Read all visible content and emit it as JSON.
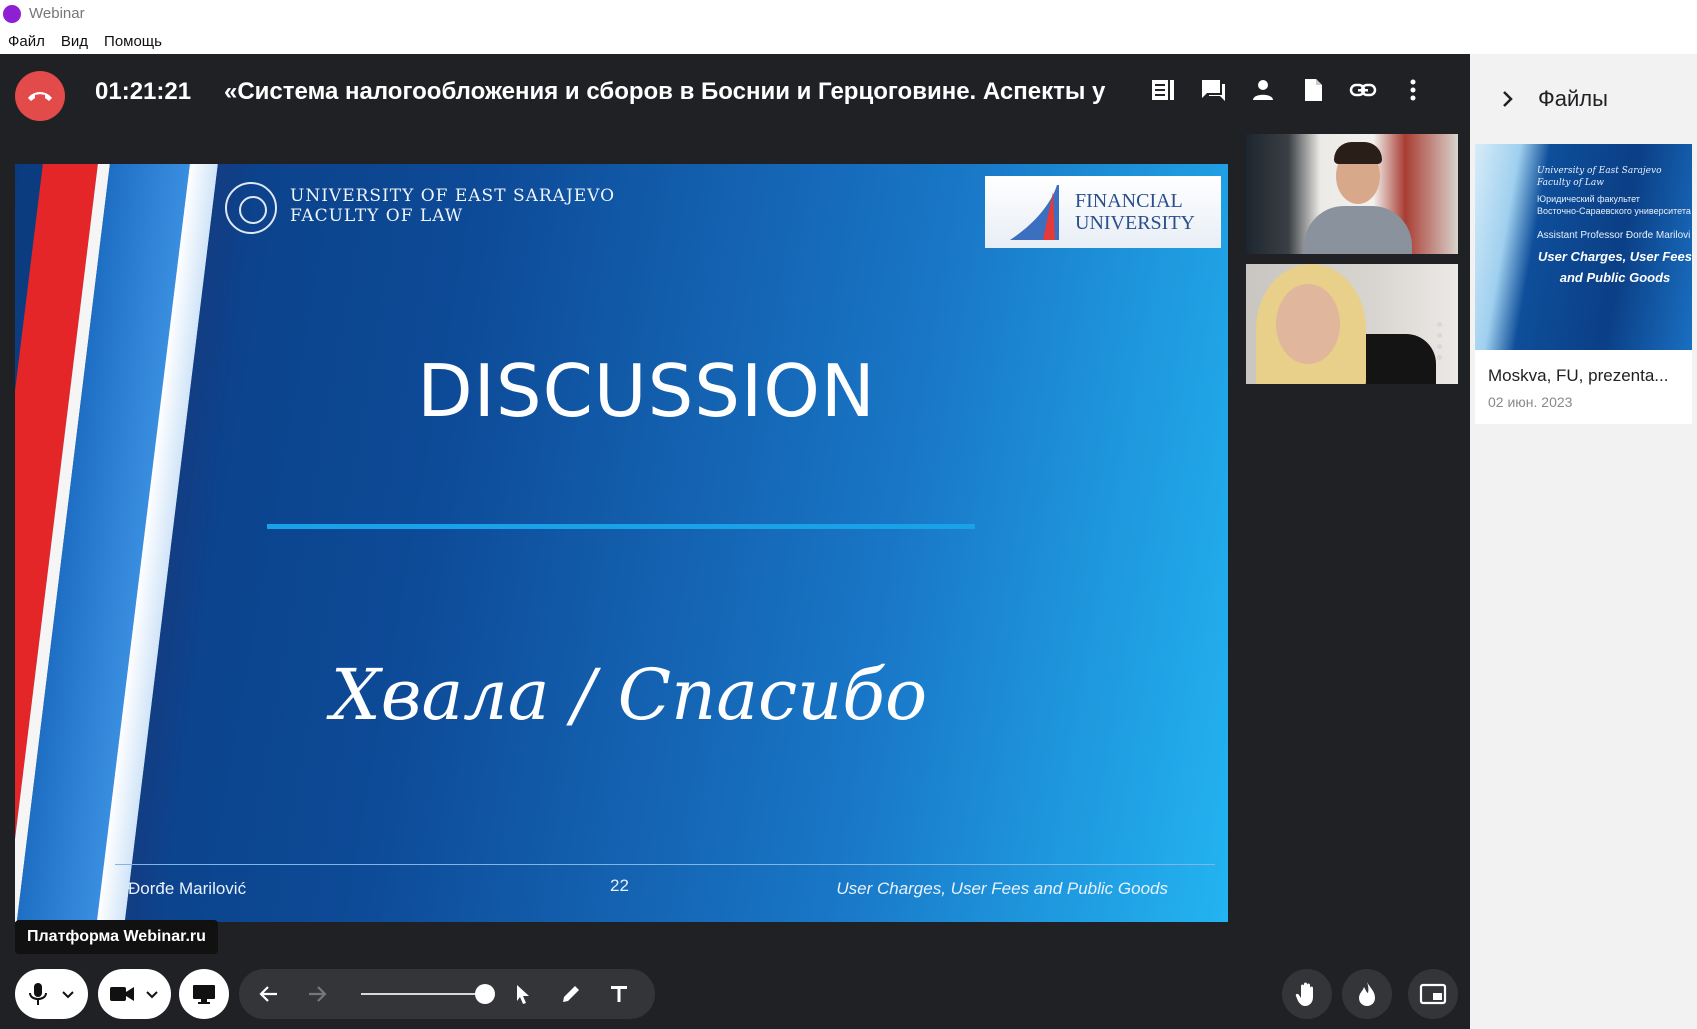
{
  "window": {
    "title": "Webinar"
  },
  "menu": [
    "Файл",
    "Вид",
    "Помощь"
  ],
  "header": {
    "timer": "01:21:21",
    "session_title": "«Система налогообложения и сборов в Боснии и Герцоговине. Аспекты у"
  },
  "slide": {
    "university_line1": "UNIVERSITY OF EAST SARAJEVO",
    "university_line2": "FACULTY OF LAW",
    "partner_line1": "FINANCIAL",
    "partner_line2": "UNIVERSITY",
    "heading": "DISCUSSION",
    "thanks": "Хвала / Спасибо",
    "author": "Đorđe Marilović",
    "page_number": "22",
    "topic": "User Charges, User Fees and Public Goods"
  },
  "tooltip": {
    "platform": "Платформа Webinar.ru"
  },
  "files_panel": {
    "title": "Файлы",
    "files": [
      {
        "name": "Moskva, FU, prezenta...",
        "date": "02 июн. 2023",
        "thumb_line1": "University of East Sarajevo",
        "thumb_line2": "Faculty of Law",
        "thumb_line3": "Юридический факультет",
        "thumb_line4": "Восточно-Сараевского университета",
        "thumb_author": "Assistant Professor Đorđe Marilovi",
        "thumb_title": "User Charges, User Fees and Public Goods"
      }
    ]
  },
  "colors": {
    "hangup": "#e34b4b",
    "main_bg": "#202124",
    "panel_bg": "#f2f2f2",
    "accent": "#8e1fd3"
  }
}
